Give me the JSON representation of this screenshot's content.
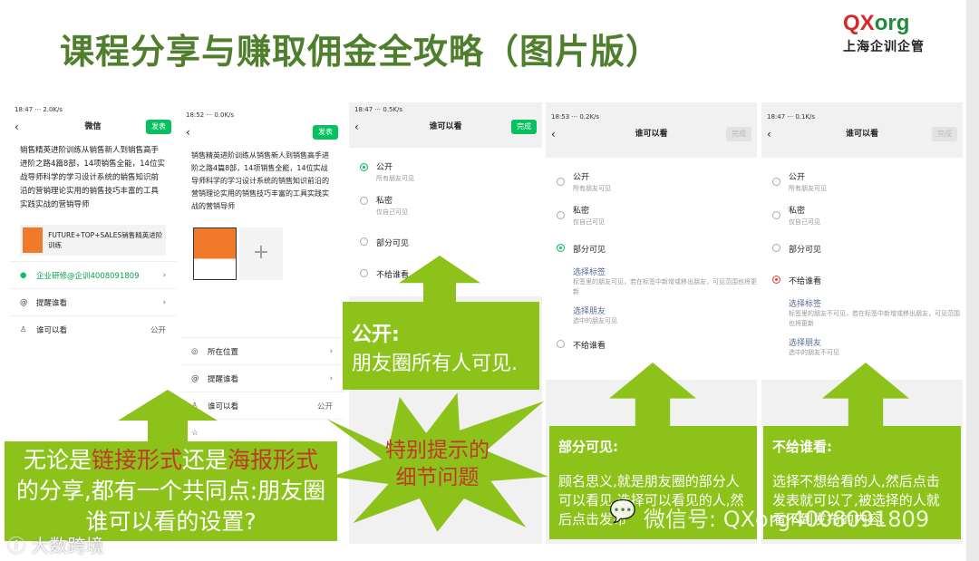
{
  "title": "课程分享与赚取佣金全攻略（图片版）",
  "logo": {
    "mark": "QXorg",
    "subtitle": "上海企训企管"
  },
  "post_text": "销售精英进阶训练从销售新人到销售高手进阶之路4篇8部，14项销售全能，14位实战导师科学的学习设计系统的销售知识前沿的营销理论实用的销售技巧丰富的工具实践实战的营销导师",
  "phone1": {
    "status_time": "18:47",
    "status_right": "2.0K/s",
    "nav_title": "微信",
    "publish": "发表",
    "link_title": "FUTURE+TOP+SALES销售精英进阶训练",
    "location": "企业研修@企训4008091809",
    "remind": "提醒谁看",
    "who": "谁可以看",
    "who_value": "公开"
  },
  "phone2": {
    "status_time": "18:52",
    "status_right": "0.0K/s",
    "publish": "发表",
    "add": "+",
    "location": "所在位置",
    "remind": "提醒谁看",
    "who": "谁可以看",
    "who_value": "公开"
  },
  "who_screen": {
    "title": "谁可以看",
    "done": "完成",
    "public": "公开",
    "public_sub": "所有朋友可见",
    "private": "私密",
    "private_sub": "仅自己可见",
    "partial": "部分可见",
    "exclude": "不给谁看",
    "tag": "选择标签",
    "tag_sub_partial": "标签里的朋友可见，若在标签中新增或移出朋友，可见范围也将更新",
    "tag_sub_exclude": "标签里的朋友不可见，若在标签中新增或移出朋友，可见范围也将更新",
    "friend": "选择朋友",
    "friend_sub_partial": "选中的朋友可见",
    "friend_sub_exclude": "选中的朋友不可见"
  },
  "phone3": {
    "status_time": "18:47",
    "status_right": "0.5K/s"
  },
  "phone4": {
    "status_time": "18:53",
    "status_right": "0.2K/s"
  },
  "phone5": {
    "status_time": "18:47",
    "status_right": "0.1K/s"
  },
  "callouts": {
    "main": {
      "p1": "无论是",
      "r1": "链接形式",
      "p2": "还是",
      "r2": "海报形式",
      "p3": "的分享,都有一个共同点:朋友圈谁可以看的设置?"
    },
    "star": "特别提示的细节问题",
    "public_title": "公开:",
    "public_body": "朋友圈所有人可见.",
    "partial_title": "部分可见:",
    "partial_body": "顾名思义,就是朋友圈的部分人可以看见,选择可以看见的人,然后点击发布",
    "exclude_title": "不给谁看:",
    "exclude_body": "选择不想给看的人,然后点击发表就可以了,被选择的人就看不到发布的内容."
  },
  "watermarks": {
    "wechat": "微信号: QXorg4008091809",
    "corner": "大数跨境"
  },
  "colors": {
    "accent_green": "#8cc21a",
    "title_green": "#4f7f2c",
    "highlight_red": "#c0392b",
    "wechat_green": "#07c160"
  }
}
